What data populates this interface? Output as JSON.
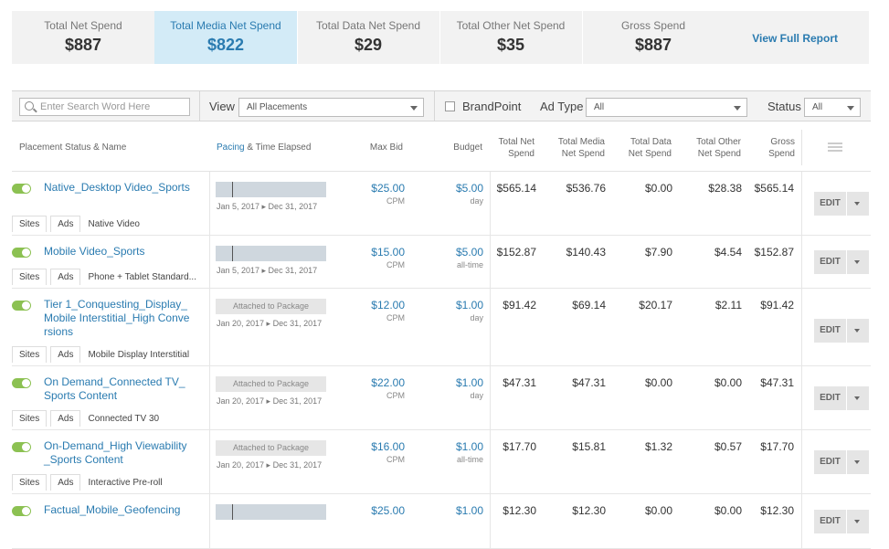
{
  "summary": {
    "metrics": [
      {
        "label": "Total Net Spend",
        "value": "$887"
      },
      {
        "label": "Total Media Net Spend",
        "value": "$822"
      },
      {
        "label": "Total Data Net Spend",
        "value": "$29"
      },
      {
        "label": "Total Other Net Spend",
        "value": "$35"
      },
      {
        "label": "Gross Spend",
        "value": "$887"
      }
    ],
    "full_report": "View Full Report"
  },
  "filters": {
    "search_placeholder": "Enter Search Word Here",
    "view_label": "View",
    "view_value": "All Placements",
    "brandpoint_label": "BrandPoint",
    "adtype_label": "Ad Type",
    "adtype_value": "All",
    "status_label": "Status",
    "status_value": "All"
  },
  "columns": {
    "name": "Placement Status & Name",
    "pacing_a": "Pacing",
    "pacing_b": " & Time Elapsed",
    "max_bid": "Max Bid",
    "budget": "Budget",
    "total_net_1": "Total Net",
    "total_net_2": "Spend",
    "media_net_1": "Total Media",
    "media_net_2": "Net Spend",
    "data_net_1": "Total Data",
    "data_net_2": "Net Spend",
    "other_net_1": "Total Other",
    "other_net_2": "Net Spend",
    "gross_1": "Gross",
    "gross_2": "Spend"
  },
  "tabs": {
    "sites": "Sites",
    "ads": "Ads"
  },
  "edit_label": "EDIT",
  "rows": [
    {
      "name": "Native_Desktop Video_Sports",
      "subtype": "Native Video",
      "pacing": "bar",
      "dates": "Jan 5, 2017 ▸ Dec 31, 2017",
      "bid": "$25.00",
      "bid_unit": "CPM",
      "budget": "$5.00",
      "budget_unit": "day",
      "total_net": "$565.14",
      "media_net": "$536.76",
      "data_net": "$0.00",
      "other_net": "$28.38",
      "gross": "$565.14"
    },
    {
      "name": "Mobile Video_Sports",
      "subtype": "Phone + Tablet Standard...",
      "pacing": "bar",
      "dates": "Jan 5, 2017 ▸ Dec 31, 2017",
      "bid": "$15.00",
      "bid_unit": "CPM",
      "budget": "$5.00",
      "budget_unit": "all-time",
      "total_net": "$152.87",
      "media_net": "$140.43",
      "data_net": "$7.90",
      "other_net": "$4.54",
      "gross": "$152.87"
    },
    {
      "name": "Tier 1_Conquesting_Display_Mobile Interstitial_High Conversions",
      "subtype": "Mobile Display Interstitial",
      "pacing": "Attached to Package",
      "dates": "Jan 20, 2017 ▸ Dec 31, 2017",
      "bid": "$12.00",
      "bid_unit": "CPM",
      "budget": "$1.00",
      "budget_unit": "day",
      "total_net": "$91.42",
      "media_net": "$69.14",
      "data_net": "$20.17",
      "other_net": "$2.11",
      "gross": "$91.42"
    },
    {
      "name": "On Demand_Connected TV_Sports Content",
      "subtype": "Connected TV 30",
      "pacing": "Attached to Package",
      "dates": "Jan 20, 2017 ▸ Dec 31, 2017",
      "bid": "$22.00",
      "bid_unit": "CPM",
      "budget": "$1.00",
      "budget_unit": "day",
      "total_net": "$47.31",
      "media_net": "$47.31",
      "data_net": "$0.00",
      "other_net": "$0.00",
      "gross": "$47.31"
    },
    {
      "name": "On-Demand_High Viewability_Sports Content",
      "subtype": "Interactive Pre-roll",
      "pacing": "Attached to Package",
      "dates": "Jan 20, 2017 ▸ Dec 31, 2017",
      "bid": "$16.00",
      "bid_unit": "CPM",
      "budget": "$1.00",
      "budget_unit": "all-time",
      "total_net": "$17.70",
      "media_net": "$15.81",
      "data_net": "$1.32",
      "other_net": "$0.57",
      "gross": "$17.70"
    },
    {
      "name": "Factual_Mobile_Geofencing",
      "subtype": "",
      "pacing": "bar",
      "dates": "",
      "bid": "$25.00",
      "bid_unit": "",
      "budget": "$1.00",
      "budget_unit": "",
      "total_net": "$12.30",
      "media_net": "$12.30",
      "data_net": "$0.00",
      "other_net": "$0.00",
      "gross": "$12.30"
    }
  ]
}
